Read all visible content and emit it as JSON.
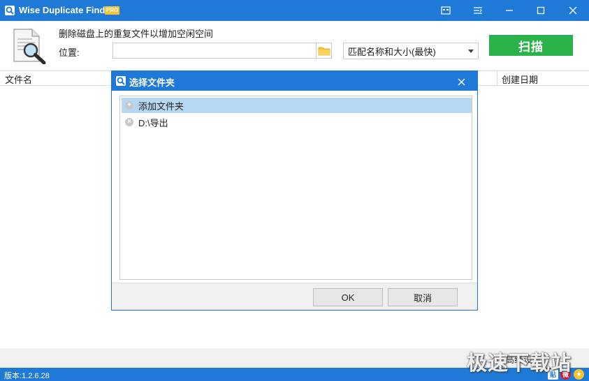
{
  "window": {
    "title": "Wise Duplicate Finder",
    "badge": "PRO",
    "controls": [
      "theme-icon",
      "menu-icon",
      "minimize-icon",
      "maximize-icon",
      "close-icon"
    ]
  },
  "top": {
    "tagline": "删除磁盘上的重复文件以增加空闲空间",
    "location_label": "位置:",
    "location_value": "",
    "match_mode": "匹配名称和大小(最快)",
    "scan_label": "扫描"
  },
  "list": {
    "columns": [
      "文件名",
      "创建日期"
    ]
  },
  "bottom": {
    "advanced_settings": "高级设置"
  },
  "status": {
    "version": "版本:1.2.6.28",
    "icons": [
      "tieba-icon",
      "weibo-icon",
      "star-icon"
    ]
  },
  "watermark": "极速下载站",
  "dialog": {
    "title": "选择文件夹",
    "items": [
      {
        "label": "添加文件夹",
        "icon": "add-icon",
        "selected": true
      },
      {
        "label": "D:\\导出",
        "icon": "remove-icon",
        "selected": false
      }
    ],
    "ok_label": "OK",
    "cancel_label": "取消"
  },
  "colors": {
    "titlebar": "#1e7ad6",
    "scan_button": "#2bb34b",
    "selection": "#b7d8f3",
    "pro_badge": "#f4c430"
  }
}
